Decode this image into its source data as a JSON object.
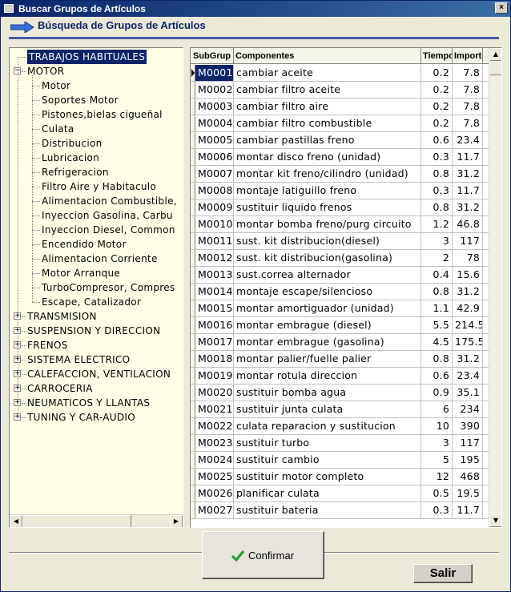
{
  "window": {
    "title": "Buscar Grupos de Artículos",
    "close_label": "×"
  },
  "header": {
    "title": "Búsqueda de Grupos de Artículos"
  },
  "tree": {
    "items": [
      {
        "label": "TRABAJOS HABITUALES",
        "level": 0,
        "selected": true,
        "expander": ""
      },
      {
        "label": "MOTOR",
        "level": 0,
        "expander": "−"
      },
      {
        "label": "Motor",
        "level": 1
      },
      {
        "label": "Soportes Motor",
        "level": 1
      },
      {
        "label": "Pistones,bielas cigueñal",
        "level": 1
      },
      {
        "label": "Culata",
        "level": 1
      },
      {
        "label": "Distribucion",
        "level": 1
      },
      {
        "label": "Lubricacion",
        "level": 1
      },
      {
        "label": "Refrigeracion",
        "level": 1
      },
      {
        "label": "Filtro Aire y Habitaculo",
        "level": 1
      },
      {
        "label": "Alimentacion Combustible,",
        "level": 1
      },
      {
        "label": "Inyeccion Gasolina, Carbu",
        "level": 1
      },
      {
        "label": "Inyeccion Diesel, Common",
        "level": 1
      },
      {
        "label": "Encendido Motor",
        "level": 1
      },
      {
        "label": "Alimentacion Corriente",
        "level": 1
      },
      {
        "label": "Motor Arranque",
        "level": 1
      },
      {
        "label": "TurboCompresor, Compres",
        "level": 1
      },
      {
        "label": "Escape, Catalizador",
        "level": 1
      },
      {
        "label": "TRANSMISION",
        "level": 0,
        "expander": "+"
      },
      {
        "label": "SUSPENSION Y DIRECCION",
        "level": 0,
        "expander": "+"
      },
      {
        "label": "FRENOS",
        "level": 0,
        "expander": "+"
      },
      {
        "label": "SISTEMA ELECTRICO",
        "level": 0,
        "expander": "+"
      },
      {
        "label": "CALEFACCION, VENTILACION",
        "level": 0,
        "expander": "+"
      },
      {
        "label": "CARROCERIA",
        "level": 0,
        "expander": "+"
      },
      {
        "label": "NEUMATICOS Y LLANTAS",
        "level": 0,
        "expander": "+"
      },
      {
        "label": "TUNING Y CAR-AUDIO",
        "level": 0,
        "expander": "+"
      }
    ]
  },
  "grid": {
    "columns": [
      "SubGrup",
      "Componentes",
      "Tiempo",
      "Importe"
    ],
    "rows": [
      [
        "M0001",
        "cambiar aceite",
        "0.2",
        "7.8"
      ],
      [
        "M0002",
        "cambiar filtro aceite",
        "0.2",
        "7.8"
      ],
      [
        "M0003",
        "cambiar filtro aire",
        "0.2",
        "7.8"
      ],
      [
        "M0004",
        "cambiar filtro combustible",
        "0.2",
        "7.8"
      ],
      [
        "M0005",
        "cambiar pastillas freno",
        "0.6",
        "23.4"
      ],
      [
        "M0006",
        "montar disco freno (unidad)",
        "0.3",
        "11.7"
      ],
      [
        "M0007",
        "montar kit freno/cilindro (unidad)",
        "0.8",
        "31.2"
      ],
      [
        "M0008",
        "montaje latiguillo freno",
        "0.3",
        "11.7"
      ],
      [
        "M0009",
        "sustituir liquido frenos",
        "0.8",
        "31.2"
      ],
      [
        "M0010",
        "montar bomba freno/purg circuito",
        "1.2",
        "46.8"
      ],
      [
        "M0011",
        "sust. kit distribucion(diesel)",
        "3",
        "117"
      ],
      [
        "M0012",
        "sust. kit distribucion(gasolina)",
        "2",
        "78"
      ],
      [
        "M0013",
        "sust.correa alternador",
        "0.4",
        "15.6"
      ],
      [
        "M0014",
        "montaje escape/silencioso",
        "0.8",
        "31.2"
      ],
      [
        "M0015",
        "montar amortiguador (unidad)",
        "1.1",
        "42.9"
      ],
      [
        "M0016",
        "montar embrague (diesel)",
        "5.5",
        "214.5"
      ],
      [
        "M0017",
        "montar embrague (gasolina)",
        "4.5",
        "175.5"
      ],
      [
        "M0018",
        "montar palier/fuelle palier",
        "0.8",
        "31.2"
      ],
      [
        "M0019",
        "montar rotula direccion",
        "0.6",
        "23.4"
      ],
      [
        "M0020",
        "sustituir bomba agua",
        "0.9",
        "35.1"
      ],
      [
        "M0021",
        "sustituir junta culata",
        "6",
        "234"
      ],
      [
        "M0022",
        "culata reparacion y sustitucion",
        "10",
        "390"
      ],
      [
        "M0023",
        "sustituir turbo",
        "3",
        "117"
      ],
      [
        "M0024",
        "sustituir cambio",
        "5",
        "195"
      ],
      [
        "M0025",
        "sustituir motor completo",
        "12",
        "468"
      ],
      [
        "M0026",
        "planificar culata",
        "0.5",
        "19.5"
      ],
      [
        "M0027",
        "sustituir bateria",
        "0.3",
        "11.7"
      ]
    ]
  },
  "buttons": {
    "confirm_label": "Confirmar",
    "exit_label": "Salir"
  },
  "colors": {
    "selection": "#0a246a",
    "tree_bg": "#ffffe6",
    "accent_line": "#4a5aa5"
  },
  "icons": {
    "arrow": "arrow-right-icon",
    "check": "check-icon"
  }
}
